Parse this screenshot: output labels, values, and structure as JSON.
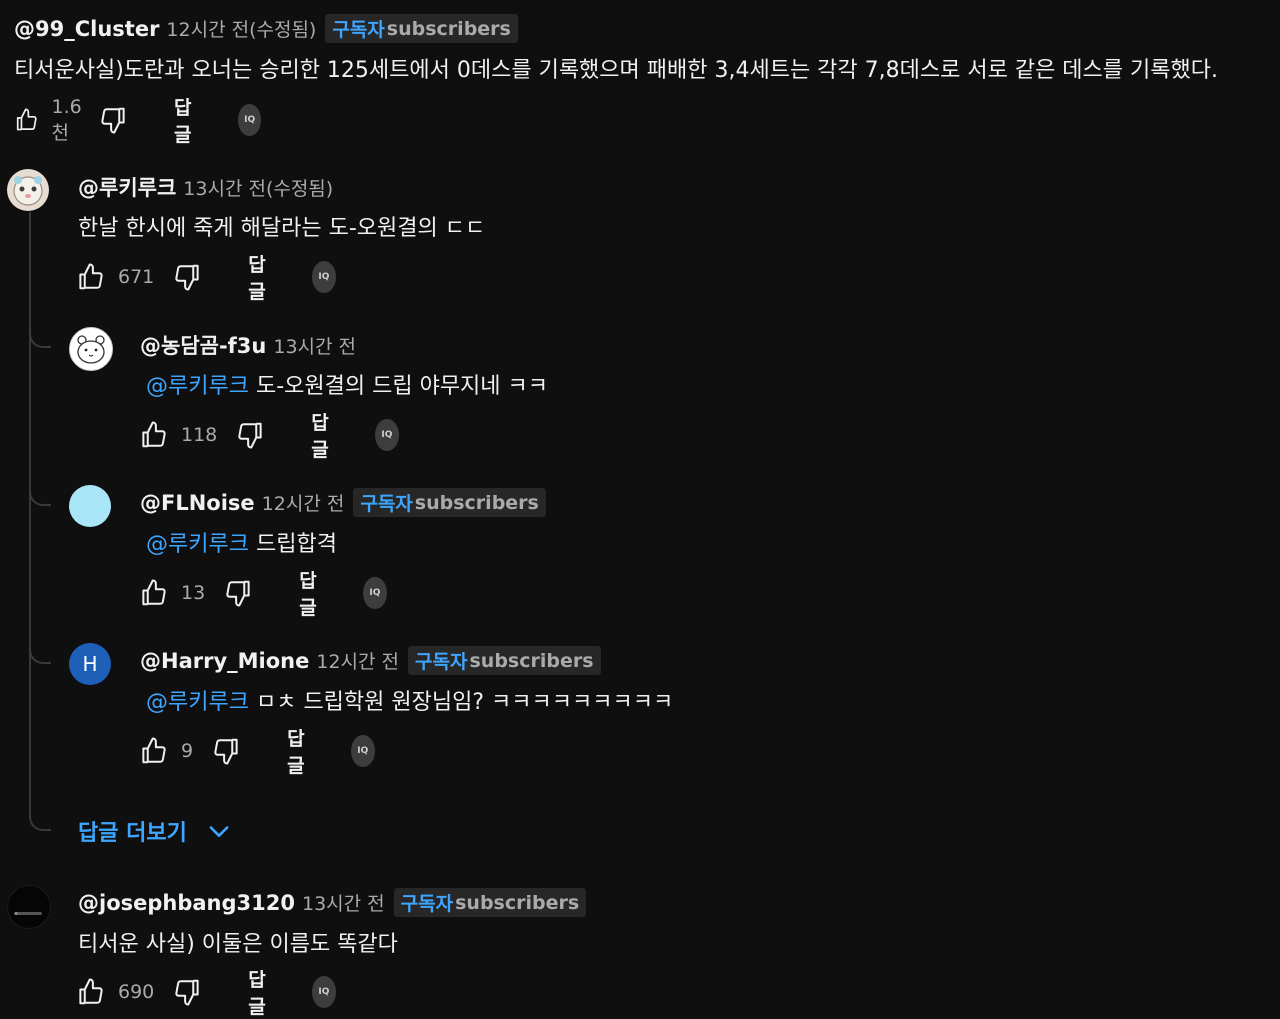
{
  "actions": {
    "reply_label": "답글",
    "iq_label": "IQ"
  },
  "top_comment": {
    "author": "@99_Cluster",
    "time": "12시간 전(수정됨)",
    "badge_ko": "구독자",
    "badge_en": "subscribers",
    "text": "티서운사실)도란과 오너는 승리한 125세트에서 0데스를 기록했으며 패배한 3,4세트는 각각 7,8데스로 서로 같은 데스를 기록했다.",
    "likes": "1.6천"
  },
  "thread": {
    "parent": {
      "author": "@루키루크",
      "time": "13시간 전(수정됨)",
      "text": "한날 한시에 죽게 해달라는 도-오원결의 ㄷㄷ",
      "likes": "671"
    },
    "replies": [
      {
        "author": "@농담곰-f3u",
        "time": "13시간 전",
        "mention": "@루키루크",
        "text": "도-오원결의 드립 야무지네 ㅋㅋ",
        "likes": "118"
      },
      {
        "author": "@FLNoise",
        "time": "12시간 전",
        "badge_ko": "구독자",
        "badge_en": "subscribers",
        "mention": "@루키루크",
        "text": "드립합격",
        "likes": "13"
      },
      {
        "author": "@Harry_Mione",
        "avatar_letter": "H",
        "time": "12시간 전",
        "badge_ko": "구독자",
        "badge_en": "subscribers",
        "mention": "@루키루크",
        "text": "ㅁㅊ 드립학원 원장님임? ㅋㅋㅋㅋㅋㅋㅋㅋㅋ",
        "likes": "9"
      }
    ],
    "more_replies_label": "답글 더보기"
  },
  "last_comment": {
    "author": "@josephbang3120",
    "time": "13시간 전",
    "badge_ko": "구독자",
    "badge_en": "subscribers",
    "text": "티서운 사실) 이둘은 이름도 똑같다",
    "likes": "690"
  },
  "colors": {
    "background": "#0f0f0f",
    "link": "#3ea6ff",
    "muted": "#aaaaaa",
    "badge_bg": "#272727"
  }
}
